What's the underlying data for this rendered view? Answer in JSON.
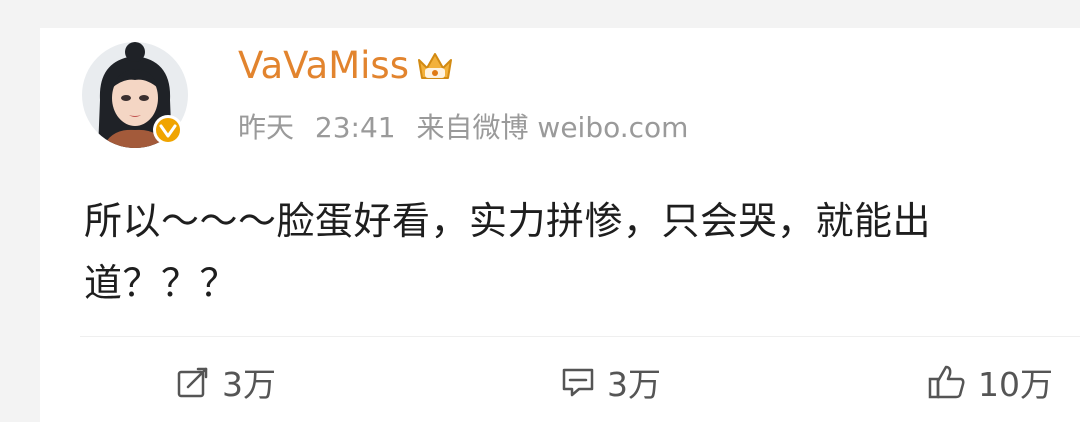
{
  "post": {
    "username": "VaVaMiss",
    "date": "昨天",
    "time": "23:41",
    "source": "来自微博 weibo.com",
    "text": "所以～～～脸蛋好看，实力拼惨，只会哭，就能出道？？？"
  },
  "actions": {
    "repost_count": "3万",
    "comment_count": "3万",
    "like_count": "10万"
  },
  "icons": {
    "avatar": "avatar-illustration",
    "vip": "crown-icon",
    "verified": "verified-badge-icon",
    "repost": "repost-icon",
    "comment": "comment-icon",
    "like": "thumbs-up-icon"
  },
  "colors": {
    "username": "#e2842e",
    "meta": "#9a9a9a",
    "text": "#1e1e1e",
    "actions": "#555555",
    "verified": "#f0a400"
  }
}
